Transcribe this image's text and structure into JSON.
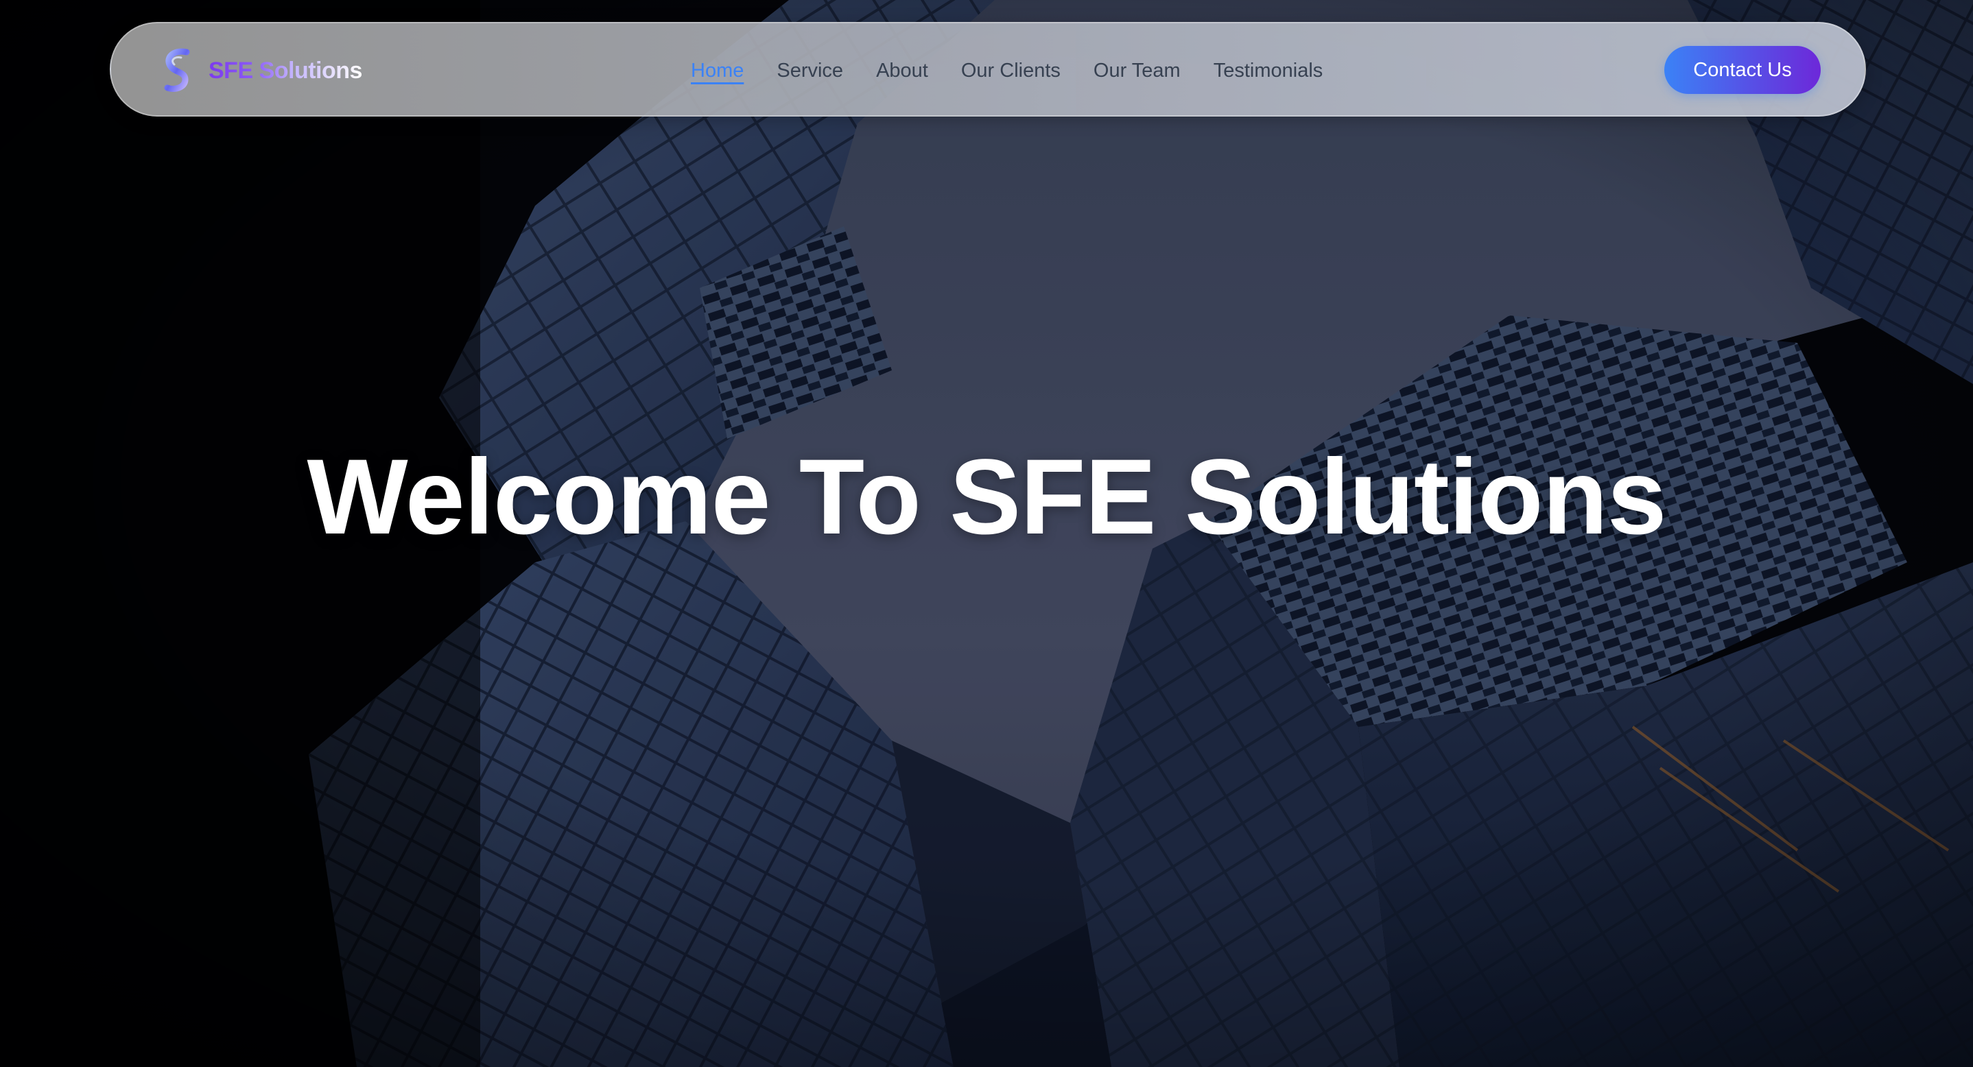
{
  "brand": {
    "name": "SFE Solutions",
    "logo_icon": "s-logo-icon"
  },
  "nav": {
    "items": [
      {
        "label": "Home",
        "active": true
      },
      {
        "label": "Service",
        "active": false
      },
      {
        "label": "About",
        "active": false
      },
      {
        "label": "Our Clients",
        "active": false
      },
      {
        "label": "Our Team",
        "active": false
      },
      {
        "label": "Testimonials",
        "active": false
      }
    ]
  },
  "cta": {
    "label": "Contact Us"
  },
  "hero": {
    "title": "Welcome To SFE Solutions"
  },
  "colors": {
    "accent_blue": "#3b82f6",
    "accent_purple": "#6d28d9",
    "nav_text": "#374151",
    "hero_overlay": "#1e293b"
  }
}
